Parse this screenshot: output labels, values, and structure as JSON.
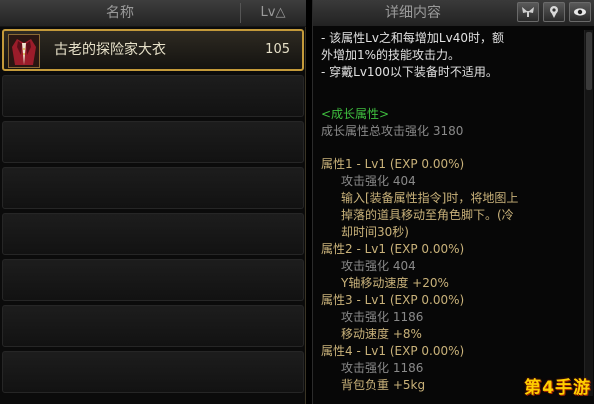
{
  "list": {
    "col_name": "名称",
    "col_lv": "Lv△",
    "items": [
      {
        "name": "古老的探险家大衣",
        "lv": "105"
      }
    ]
  },
  "detail": {
    "title": "详细内容",
    "lines": [
      {
        "text": "- 该属性Lv之和每增加Lv40时，额",
        "color": "white"
      },
      {
        "text": "外增加1%的技能攻击力。",
        "color": "white"
      },
      {
        "text": "- 穿戴Lv100以下装备时不适用。",
        "color": "white"
      },
      {
        "text": "<成长属性>",
        "color": "green"
      },
      {
        "text": "成长属性总攻击强化 3180",
        "color": "gray"
      },
      {
        "text": "属性1 - Lv1 (EXP 0.00%)",
        "color": "gold"
      },
      {
        "text": "攻击强化 404",
        "color": "gray"
      },
      {
        "text": "输入[装备属性指令]时，将地图上",
        "color": "gold"
      },
      {
        "text": "掉落的道具移动至角色脚下。(冷",
        "color": "gold"
      },
      {
        "text": "却时间30秒)",
        "color": "gold"
      },
      {
        "text": "属性2 - Lv1 (EXP 0.00%)",
        "color": "gold"
      },
      {
        "text": "攻击强化 404",
        "color": "gray"
      },
      {
        "text": "Y轴移动速度 +20%",
        "color": "gold"
      },
      {
        "text": "属性3 - Lv1 (EXP 0.00%)",
        "color": "gold"
      },
      {
        "text": "攻击强化 1186",
        "color": "gray"
      },
      {
        "text": "移动速度 +8%",
        "color": "gold"
      },
      {
        "text": "属性4 - Lv1 (EXP 0.00%)",
        "color": "gold"
      },
      {
        "text": "攻击强化 1186",
        "color": "gray"
      },
      {
        "text": "背包负重 +5kg",
        "color": "gold"
      }
    ]
  },
  "watermark": "第4手游",
  "icons": [
    "wings-icon",
    "map-pin-icon",
    "eye-icon"
  ]
}
